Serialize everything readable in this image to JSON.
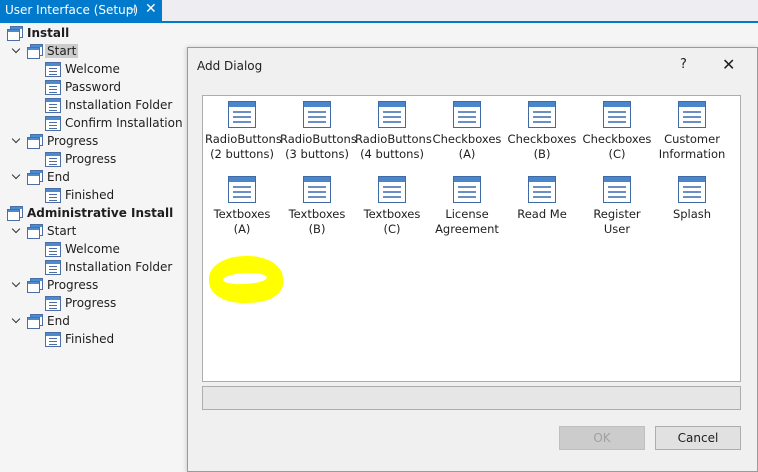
{
  "tab": {
    "title": "User Interface (Setup)",
    "pin": "⊣",
    "close": "✕"
  },
  "tree": [
    {
      "label": "Install",
      "bold": true,
      "expand": false
    },
    {
      "label": "Start",
      "selected": true,
      "expand": true
    },
    {
      "label": "Welcome"
    },
    {
      "label": "Password"
    },
    {
      "label": "Installation Folder"
    },
    {
      "label": "Confirm Installation"
    },
    {
      "label": "Progress",
      "expand": true
    },
    {
      "label": "Progress"
    },
    {
      "label": "End",
      "expand": true
    },
    {
      "label": "Finished"
    },
    {
      "label": "Administrative Install",
      "bold": true,
      "expand": false
    },
    {
      "label": "Start",
      "expand": true
    },
    {
      "label": "Welcome"
    },
    {
      "label": "Installation Folder"
    },
    {
      "label": "Progress",
      "expand": true
    },
    {
      "label": "Progress"
    },
    {
      "label": "End",
      "expand": true
    },
    {
      "label": "Finished"
    }
  ],
  "dialog": {
    "title": "Add Dialog",
    "help": "?",
    "close": "✕",
    "templates": [
      {
        "line1": "RadioButtons",
        "line2": "(2 buttons)"
      },
      {
        "line1": "RadioButtons",
        "line2": "(3 buttons)"
      },
      {
        "line1": "RadioButtons",
        "line2": "(4 buttons)"
      },
      {
        "line1": "Checkboxes",
        "line2": "(A)"
      },
      {
        "line1": "Checkboxes",
        "line2": "(B)"
      },
      {
        "line1": "Checkboxes",
        "line2": "(C)"
      },
      {
        "line1": "Customer",
        "line2": "Information"
      },
      {
        "line1": "Textboxes",
        "line2": "(A)"
      },
      {
        "line1": "Textboxes",
        "line2": "(B)"
      },
      {
        "line1": "Textboxes",
        "line2": "(C)"
      },
      {
        "line1": "License",
        "line2": "Agreement"
      },
      {
        "line1": "Read Me",
        "line2": ""
      },
      {
        "line1": "Register User",
        "line2": ""
      },
      {
        "line1": "Splash",
        "line2": ""
      }
    ],
    "ok_label": "OK",
    "cancel_label": "Cancel"
  },
  "colors": {
    "accent": "#007acc",
    "highlight": "#ffff00"
  }
}
